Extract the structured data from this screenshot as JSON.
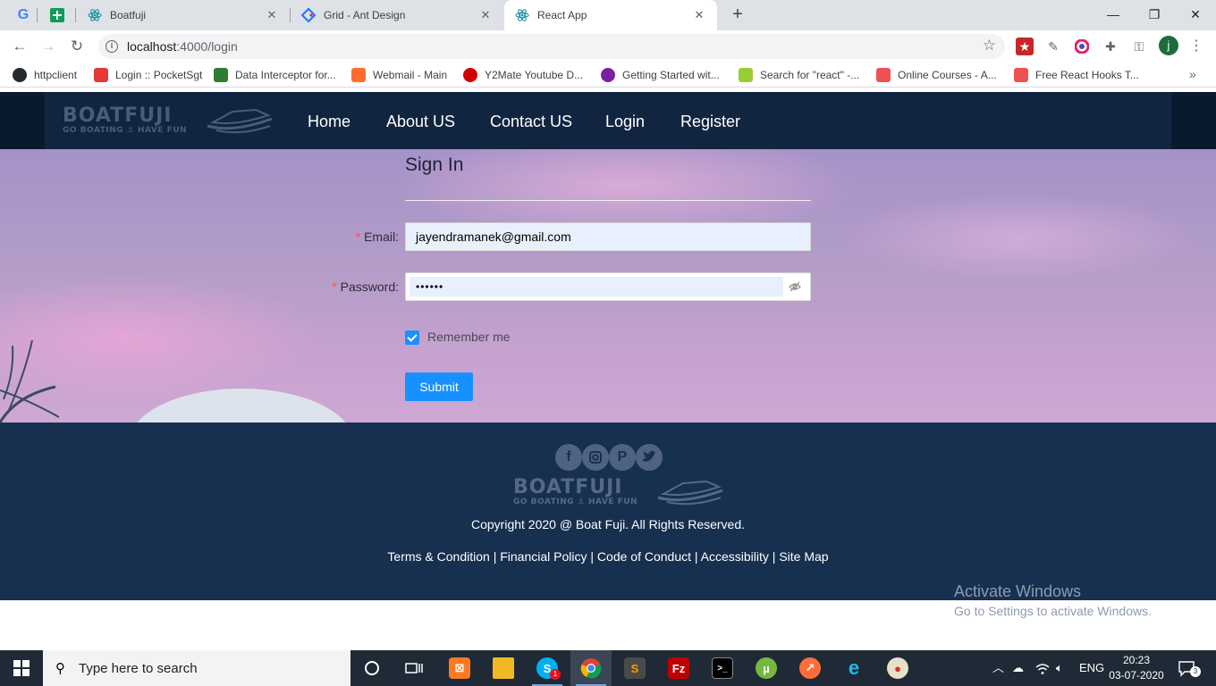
{
  "browser": {
    "tabs": [
      {
        "title": "Boatfuji"
      },
      {
        "title": "Grid - Ant Design"
      },
      {
        "title": "React App"
      }
    ],
    "url": {
      "host": "localhost",
      "rest": ":4000/login"
    },
    "bookmarks": [
      {
        "label": "httpclient",
        "icon": "github-icon",
        "color": "#24292e"
      },
      {
        "label": "Login :: PocketSgt",
        "icon": "pocketsgt-icon",
        "color": "#e53935"
      },
      {
        "label": "Data Interceptor for...",
        "icon": "interceptor-icon",
        "color": "#2e7d32"
      },
      {
        "label": "Webmail - Main",
        "icon": "cpanel-icon",
        "color": "#ff6c2c"
      },
      {
        "label": "Y2Mate Youtube D...",
        "icon": "y2mate-icon",
        "color": "#d50000"
      },
      {
        "label": "Getting Started wit...",
        "icon": "redux-icon",
        "color": "#7b1fa2"
      },
      {
        "label": "Search for \"react\" -...",
        "icon": "upwork-icon",
        "color": "#9acd32"
      },
      {
        "label": "Online Courses - A...",
        "icon": "udemy-icon",
        "color": "#ec5252"
      },
      {
        "label": "Free React Hooks T...",
        "icon": "udemy-icon",
        "color": "#ec5252"
      }
    ]
  },
  "site": {
    "logo": {
      "main": "BOATFUJI",
      "tagline": "GO BOATING ⚓ HAVE FUN"
    },
    "nav": [
      "Home",
      "About US",
      "Contact US",
      "Login",
      "Register"
    ],
    "active_nav": "Login"
  },
  "form": {
    "title": "Sign In",
    "email_label": "Email",
    "email_value": "jayendramanek@gmail.com",
    "password_label": "Password",
    "password_mask": "••••••",
    "remember_label": "Remember me",
    "remember_checked": true,
    "submit_label": "Submit"
  },
  "footer": {
    "social": [
      "facebook-icon",
      "instagram-icon",
      "pinterest-icon",
      "twitter-icon"
    ],
    "copyright": "Copyright 2020 @ Boat Fuji. All Rights Reserved.",
    "links": [
      "Terms & Condition",
      "Financial Policy",
      "Code of Conduct",
      "Accessibility",
      "Site Map"
    ]
  },
  "watermark": {
    "line1": "Activate Windows",
    "line2": "Go to Settings to activate Windows."
  },
  "taskbar": {
    "search_placeholder": "Type here to search",
    "language": "ENG",
    "time": "20:23",
    "date": "03-07-2020",
    "skype_badge": "1",
    "notification_count": "3"
  },
  "colors": {
    "nav_bg": "#112540",
    "footer_bg": "#173050",
    "primary": "#1890ff",
    "required": "#ff4d4f"
  }
}
